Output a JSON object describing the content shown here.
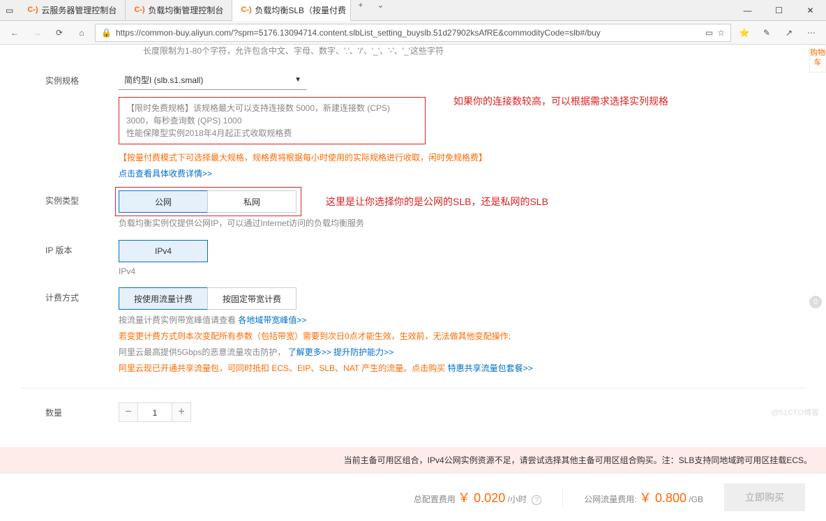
{
  "browser": {
    "tabs": [
      {
        "label": "云服务器管理控制台"
      },
      {
        "label": "负载均衡管理控制台"
      },
      {
        "label": "负载均衡SLB（按量付费",
        "active": true
      }
    ],
    "url": "https://common-buy.aliyun.com/?spm=5176.13094714.content.slbList_setting_buyslb.51d27902ksAfRE&commodityCode=slb#/buy"
  },
  "sideCart": "购物车",
  "hintTop": "长度限制为1-80个字符，允许包含中文、字母、数字、'.'、'/'、'_'、'-'、'_'这些字符",
  "spec": {
    "label": "实例规格",
    "selected": "简约型I (slb.s1.small)",
    "boxLine1": "【限时免费规格】该规格最大可以支持连接数 5000，新建连接数 (CPS) 3000，每秒查询数 (QPS) 1000",
    "boxLine2": "性能保障型实例2018年4月起正式收取规格费",
    "note": "【按量付费模式下可选择最大规格，规格费将根据每小时使用的实际规格进行收取，闲时免规格费】",
    "link": "点击查看具体收费详情>>",
    "annotation": "如果你的连接数较高，可以根据需求选择实列规格"
  },
  "type": {
    "label": "实例类型",
    "opt1": "公网",
    "opt2": "私网",
    "hint": "负载均衡实例仅提供公网IP，可以通过Internet访问的负载均衡服务",
    "annotation": "这里是让你选择你的是公网的SLB，还是私网的SLB"
  },
  "ip": {
    "label": "IP 版本",
    "opt1": "IPv4",
    "hint": "IPv4"
  },
  "billing": {
    "label": "计费方式",
    "opt1": "按使用流量计费",
    "opt2": "按固定带宽计费",
    "hint1a": "按流量计费实例带宽峰值请查看",
    "hint1b": "各地域带宽峰值>>",
    "hint2": "若变更计费方式则本次变配所有参数（包括带宽）需要到次日0点才能生效，生效前，无法做其他变配操作;",
    "hint3a": "阿里云最高提供5Gbps的恶意流量攻击防护，",
    "hint3b": "了解更多>>",
    "hint3c": "提升防护能力>>",
    "hint4a": "阿里云现已开通共享流量包，可同时抵扣 ECS、EIP、SLB、NAT 产生的流量。点击购买",
    "hint4b": "特惠共享流量包套餐>>"
  },
  "quantity": {
    "label": "数量",
    "value": "1"
  },
  "warning": "当前主备可用区组合，IPv4公网实例资源不足，请尝试选择其他主备可用区组合购买。注：SLB支持同地域跨可用区挂载ECS。",
  "footer": {
    "configLabel": "总配置费用",
    "configPrice": "￥ 0.020",
    "configUnit": "/小时",
    "trafficLabel": "公网流量费用:",
    "trafficPrice": "￥ 0.800",
    "trafficUnit": "/GB",
    "buy": "立即购买"
  },
  "badge": "0",
  "watermark": "@51CTO博客"
}
